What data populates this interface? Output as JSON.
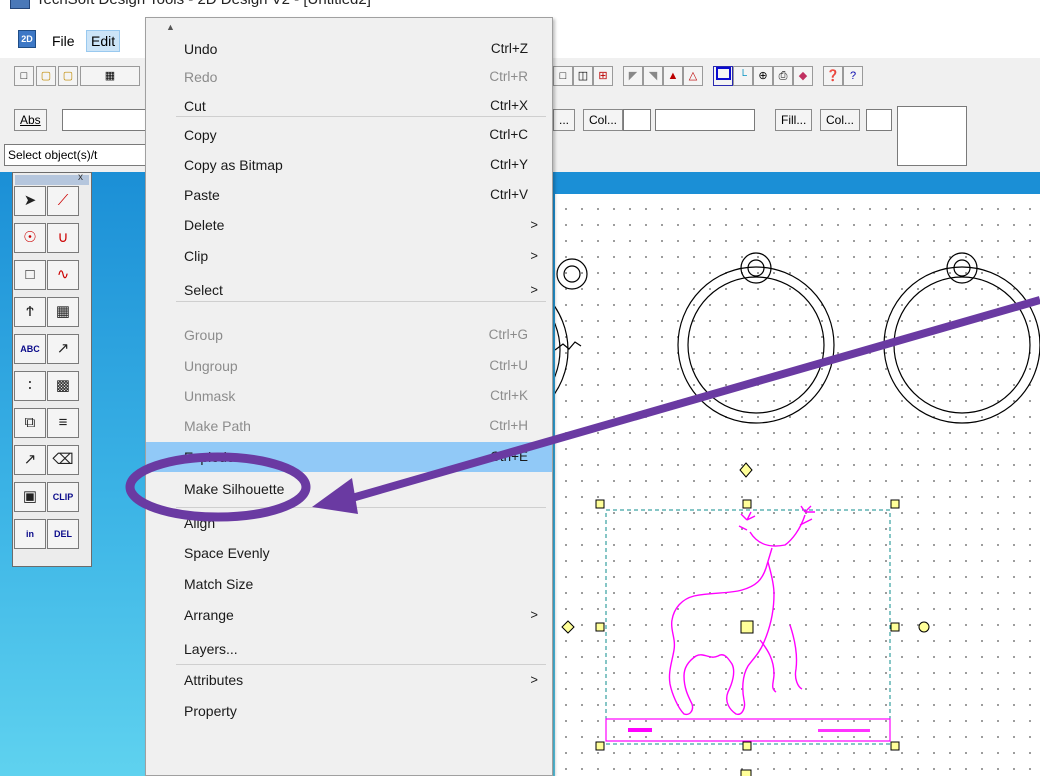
{
  "window": {
    "title": "TechSoft Design Tools - 2D Design V2 - [Untitled2]"
  },
  "menubar": {
    "app_icon": "2D",
    "items": [
      "File",
      "Edit"
    ]
  },
  "attr_bar": {
    "abs_label": "Abs",
    "buttons": [
      "...",
      "Col...",
      "Fill...",
      "Col..."
    ]
  },
  "status": {
    "prompt": "Select object(s)/t"
  },
  "palette": {
    "close_glyph": "x",
    "tools": [
      {
        "icon": "select-arrow-icon"
      },
      {
        "icon": "line-icon"
      },
      {
        "icon": "circle-radius-icon"
      },
      {
        "icon": "arc-icon"
      },
      {
        "icon": "rectangle-icon"
      },
      {
        "icon": "curve-icon"
      },
      {
        "icon": "offset-icon"
      },
      {
        "icon": "hatch-icon"
      },
      {
        "icon": "text-abc-icon",
        "text": "ABC"
      },
      {
        "icon": "dimension-icon"
      },
      {
        "icon": "points-icon"
      },
      {
        "icon": "fill-pattern-icon"
      },
      {
        "icon": "copy-icon"
      },
      {
        "icon": "align-icon"
      },
      {
        "icon": "move-icon"
      },
      {
        "icon": "eraser-icon"
      },
      {
        "icon": "node-edit-icon"
      },
      {
        "icon": "clip-icon",
        "text": "CLIP"
      },
      {
        "icon": "insert-icon",
        "text": "in"
      },
      {
        "icon": "delete-icon",
        "text": "DEL"
      }
    ]
  },
  "context_menu": {
    "items": [
      {
        "label": "Undo",
        "shortcut": "Ctrl+Z",
        "enabled": true
      },
      {
        "label": "Redo",
        "shortcut": "Ctrl+R",
        "enabled": false
      },
      {
        "label": "Cut",
        "shortcut": "Ctrl+X",
        "enabled": true
      },
      {
        "label": "Copy",
        "shortcut": "Ctrl+C",
        "enabled": true
      },
      {
        "label": "Copy as Bitmap",
        "shortcut": "Ctrl+Y",
        "enabled": true
      },
      {
        "label": "Paste",
        "shortcut": "Ctrl+V",
        "enabled": true
      },
      {
        "label": "Delete",
        "submenu": true,
        "enabled": true
      },
      {
        "label": "Clip",
        "submenu": true,
        "enabled": true
      },
      {
        "label": "Select",
        "submenu": true,
        "enabled": true
      },
      {
        "label": "Group",
        "shortcut": "Ctrl+G",
        "enabled": false
      },
      {
        "label": "Ungroup",
        "shortcut": "Ctrl+U",
        "enabled": false
      },
      {
        "label": "Unmask",
        "shortcut": "Ctrl+K",
        "enabled": false
      },
      {
        "label": "Make Path",
        "shortcut": "Ctrl+H",
        "enabled": false
      },
      {
        "label": "Explode",
        "shortcut": "Ctrl+E",
        "enabled": true,
        "highlighted": true
      },
      {
        "label": "Make Silhouette",
        "enabled": true
      },
      {
        "label": "Align",
        "enabled": true
      },
      {
        "label": "Space Evenly",
        "enabled": true
      },
      {
        "label": "Match Size",
        "enabled": true
      },
      {
        "label": "Arrange",
        "submenu": true,
        "enabled": true
      },
      {
        "label": "Layers...",
        "enabled": true
      },
      {
        "label": "Attributes",
        "submenu": true,
        "enabled": true
      },
      {
        "label": "Property",
        "enabled": true
      }
    ],
    "submenu_glyph": ">"
  },
  "canvas": {
    "selection_color": "#ff00ff",
    "handle_color": "#ffff99"
  },
  "annotation": {
    "color": "#6a3aa2"
  }
}
